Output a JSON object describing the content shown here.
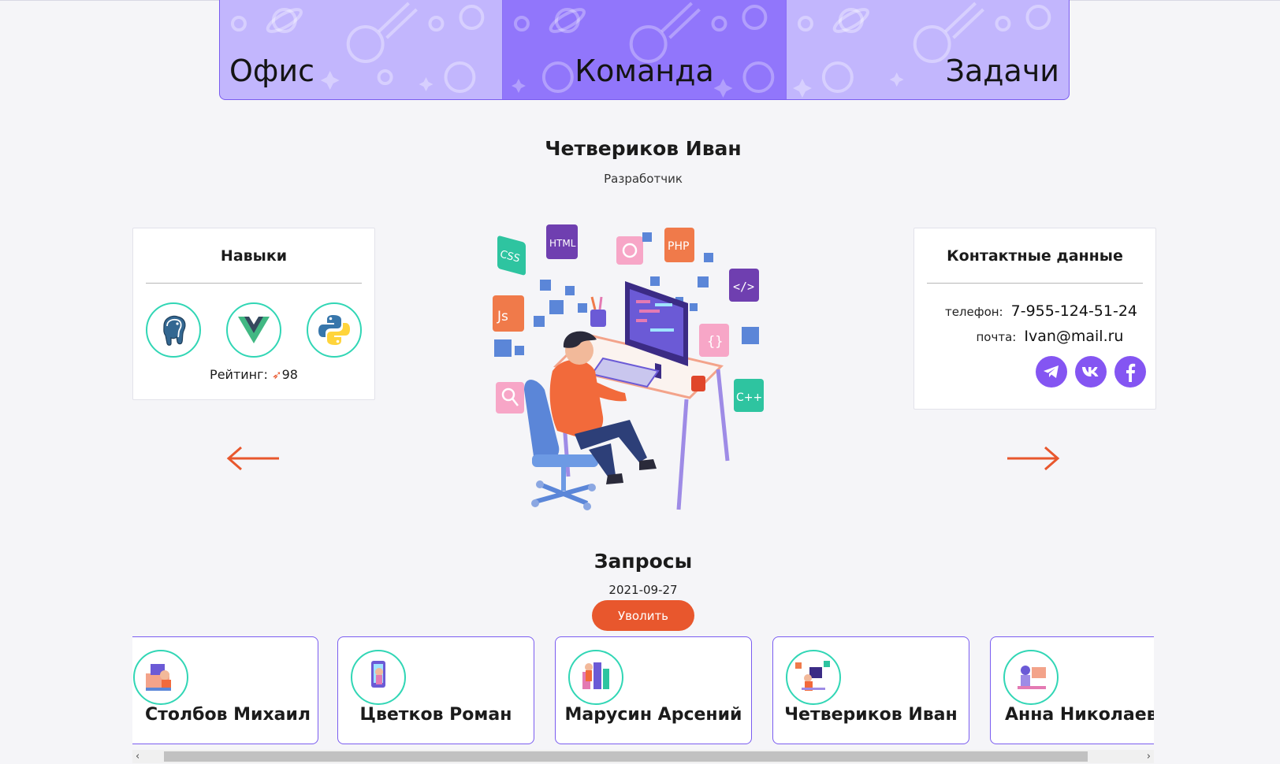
{
  "nav": {
    "tabs": [
      {
        "label": "Офис"
      },
      {
        "label": "Команда",
        "active": true
      },
      {
        "label": "Задачи"
      }
    ]
  },
  "profile": {
    "name": "Четвериков Иван",
    "role": "Разработчик"
  },
  "skills": {
    "title": "Навыки",
    "icons": [
      "postgresql-icon",
      "vue-icon",
      "python-icon"
    ],
    "rating_label": "Рейтинг:",
    "rating_value": "98"
  },
  "contacts": {
    "title": "Контактные данные",
    "phone_label": "телефон:",
    "phone": "7-955-124-51-24",
    "email_label": "почта:",
    "email": "Ivan@mail.ru",
    "socials": [
      "telegram-icon",
      "vk-icon",
      "facebook-icon"
    ]
  },
  "request": {
    "title": "Запросы",
    "date": "2021-09-27",
    "fire_button": "Уволить"
  },
  "employees": [
    {
      "name": "Столбов Михаил"
    },
    {
      "name": "Цветков Роман"
    },
    {
      "name": "Марусин Арсений"
    },
    {
      "name": "Четвериков Иван"
    },
    {
      "name": "Анна Николаевна"
    }
  ],
  "colors": {
    "accent": "#8455f2",
    "tab_bg": "#c2b6fd",
    "tab_active": "#9176fb",
    "orange": "#e8572d",
    "teal": "#31d6b5"
  }
}
